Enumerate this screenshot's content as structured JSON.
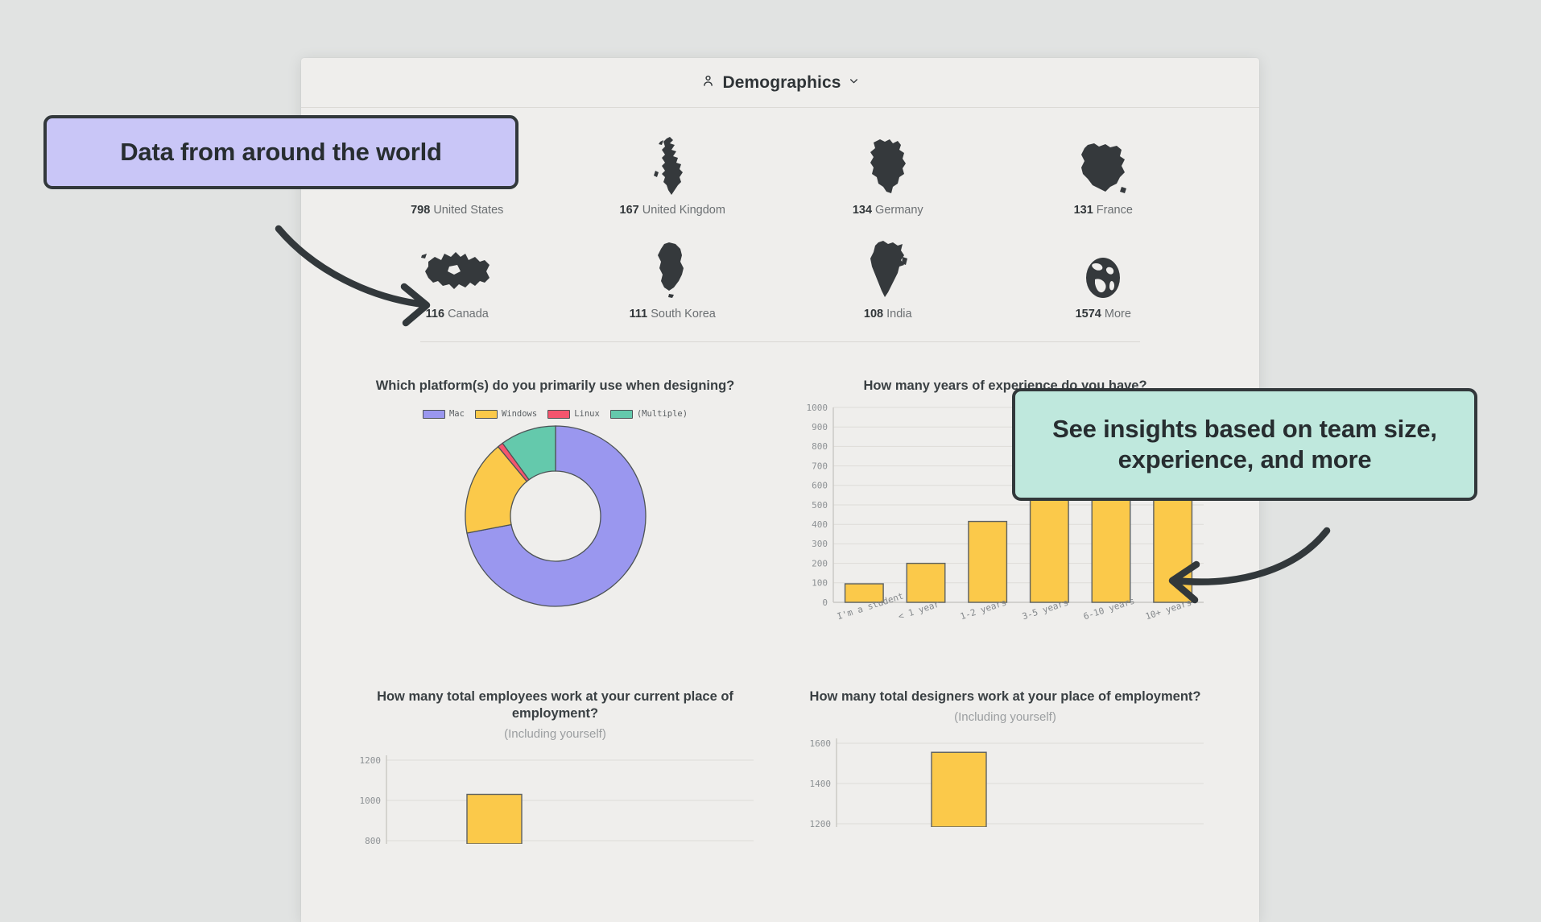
{
  "header": {
    "title": "Demographics",
    "person_icon": "person-icon",
    "chevron_icon": "chevron-down-icon"
  },
  "countries": {
    "rows": [
      [
        {
          "count": "798",
          "name": "United States",
          "icon": "map-united-states-icon"
        },
        {
          "count": "167",
          "name": "United Kingdom",
          "icon": "map-united-kingdom-icon"
        },
        {
          "count": "134",
          "name": "Germany",
          "icon": "map-germany-icon"
        },
        {
          "count": "131",
          "name": "France",
          "icon": "map-france-icon"
        }
      ],
      [
        {
          "count": "116",
          "name": "Canada",
          "icon": "map-canada-icon"
        },
        {
          "count": "111",
          "name": "South Korea",
          "icon": "map-south-korea-icon"
        },
        {
          "count": "108",
          "name": "India",
          "icon": "map-india-icon"
        },
        {
          "count": "1574",
          "name": "More",
          "icon": "globe-icon"
        }
      ]
    ]
  },
  "callouts": {
    "world": "Data from around the world",
    "insights": "See insights based on team size, experience, and more",
    "world_color": "#c9c6f7",
    "insights_color": "#bfe8dd",
    "border_color": "#32383b"
  },
  "chart_data": [
    {
      "type": "pie",
      "title": "Which platform(s) do you primarily use when designing?",
      "subtitle": "",
      "labels": [
        "Mac",
        "Windows",
        "Linux",
        "(Multiple)"
      ],
      "values": [
        72,
        17,
        1,
        10
      ],
      "colors": [
        "#9a97ef",
        "#fbc94a",
        "#f4556e",
        "#64c9ac"
      ],
      "legend_position": "top",
      "donut": true
    },
    {
      "type": "bar",
      "title": "How many years of experience do you have?",
      "subtitle": "",
      "categories": [
        "I'm a student",
        "< 1 year",
        "1-2 years",
        "3-5 years",
        "6-10 years",
        "10+ years"
      ],
      "values": [
        95,
        200,
        415,
        855,
        795,
        965
      ],
      "yticks": [
        0,
        100,
        200,
        300,
        400,
        500,
        600,
        700,
        800,
        900,
        1000
      ],
      "ylim": [
        0,
        1000
      ],
      "xlabel": "",
      "ylabel": "",
      "grid": true,
      "bar_color": "#fbc94a"
    },
    {
      "type": "bar",
      "title": "How many total employees work at your current place of employment?",
      "subtitle": "(Including yourself)",
      "categories": [
        ""
      ],
      "values": [
        1030
      ],
      "yticks": [
        800,
        1000,
        1200
      ],
      "ylim": [
        0,
        1200
      ],
      "xlabel": "",
      "ylabel": "",
      "grid": true,
      "bar_color": "#fbc94a"
    },
    {
      "type": "bar",
      "title": "How many total designers work at your place of employment?",
      "subtitle": "(Including yourself)",
      "categories": [
        ""
      ],
      "values": [
        1555
      ],
      "yticks": [
        1200,
        1400,
        1600
      ],
      "ylim": [
        0,
        1600
      ],
      "xlabel": "",
      "ylabel": "",
      "grid": true,
      "bar_color": "#fbc94a"
    }
  ]
}
